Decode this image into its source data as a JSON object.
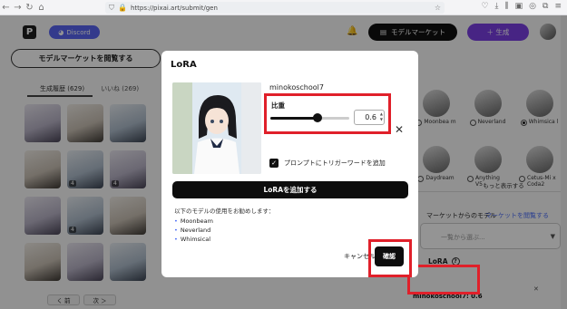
{
  "browser": {
    "url": "https://pixai.art/submit/gen"
  },
  "header": {
    "logo": "P",
    "discord_label": "Discord",
    "market_label": "モデルマーケット",
    "generate_label": "＋ 生成"
  },
  "left": {
    "browse_button": "モデルマーケットを閲覧する",
    "tabs": [
      {
        "label": "生成履歴 (629)"
      },
      {
        "label": "いいね (269)"
      }
    ],
    "thumb_badges": [
      "4",
      "4",
      "4"
    ],
    "pager_prev": "く 前",
    "pager_next": "次 ＞"
  },
  "right": {
    "models": [
      {
        "label": "Moonbea m",
        "selected": false
      },
      {
        "label": "Neverland",
        "selected": false
      },
      {
        "label": "Whimsica l",
        "selected": true
      },
      {
        "label": "Daydream",
        "selected": false
      },
      {
        "label": "Anything V5",
        "selected": false
      },
      {
        "label": "Cetus-Mi x Coda2",
        "selected": false
      }
    ],
    "more_label": "もっと表示する",
    "from_model_label": "マーケットからのモデル",
    "browse_market_link": "マーケットを閲覧する",
    "select_placeholder": "一覧から選ぶ...",
    "lora_label": "LoRA",
    "lora_chip": "minokoschool7: 0.6"
  },
  "modal": {
    "title": "LoRA",
    "model_name": "minokoschool7",
    "weight_label": "比重",
    "weight_value": "0.6",
    "weight_fraction": 0.6,
    "trigger_checkbox_label": "プロンプトにトリガーワードを追加",
    "trigger_checked": true,
    "add_button": "LoRAを追加する",
    "recommend_text": "以下のモデルの使用をお勧めします：",
    "recommended_models": [
      "Moonbeam",
      "Neverland",
      "Whimsical"
    ],
    "cancel_label": "キャンセル",
    "confirm_label": "確認"
  },
  "colors": {
    "highlight": "#e0202a",
    "primary": "#7b3fe4",
    "discord": "#5865f2",
    "link": "#4a6cf7"
  }
}
